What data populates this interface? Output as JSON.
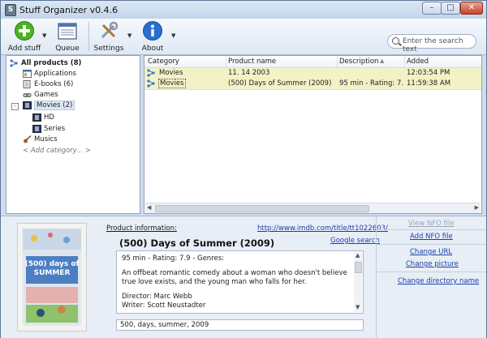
{
  "window": {
    "title": "Stuff Organizer v0.4.6",
    "app_icon_letter": "S"
  },
  "toolbar": {
    "add_stuff": "Add stuff",
    "queue": "Queue",
    "settings": "Settings",
    "about": "About",
    "search_placeholder": "Enter the search text"
  },
  "tree": {
    "root": "All products (8)",
    "items": [
      {
        "label": "Applications",
        "icon": "applications-icon"
      },
      {
        "label": "E-books (6)",
        "icon": "ebook-icon"
      },
      {
        "label": "Games",
        "icon": "games-icon"
      },
      {
        "label": "Movies (2)",
        "icon": "film-icon"
      },
      {
        "label": "HD",
        "icon": "film-icon"
      },
      {
        "label": "Series",
        "icon": "film-icon"
      },
      {
        "label": "Musics",
        "icon": "guitar-icon"
      }
    ],
    "add_category": "< Add category... >"
  },
  "list": {
    "columns": [
      "Category",
      "Product name",
      "Description",
      "Added"
    ],
    "rows": [
      {
        "category": "Movies",
        "name": "11. 14 2003",
        "description": "",
        "added": "12:03:54 PM"
      },
      {
        "category": "Movies",
        "name": "(500) Days of Summer (2009)",
        "description": "95 min - Rating: 7...",
        "added": "11:59:38 AM"
      }
    ]
  },
  "info": {
    "label": "Product information:",
    "imdb_url": "http://www.imdb.com/title/tt1022603/",
    "title": "(500) Days of Summer (2009)",
    "google_search": "Google search",
    "description_lines": [
      "95 min - Rating: 7.9 - Genres:",
      "",
      "An offbeat romantic comedy about a woman who doesn't believe",
      "true love exists, and the young man who falls for her.",
      "",
      "Director: Marc Webb",
      "Writer: Scott Neustadter"
    ],
    "keywords": "500, days, summer, 2009",
    "poster_text": "(500) days of SUMMER"
  },
  "actions": {
    "view_nfo": "View NFO file",
    "add_nfo": "Add NFO file",
    "change_url": "Change URL",
    "change_picture": "Change picture",
    "change_dir": "Change directory name"
  },
  "colors": {
    "row_highlight": "#f3f2c6",
    "link": "#1a3ea8",
    "window_bg": "#cfdcec"
  }
}
